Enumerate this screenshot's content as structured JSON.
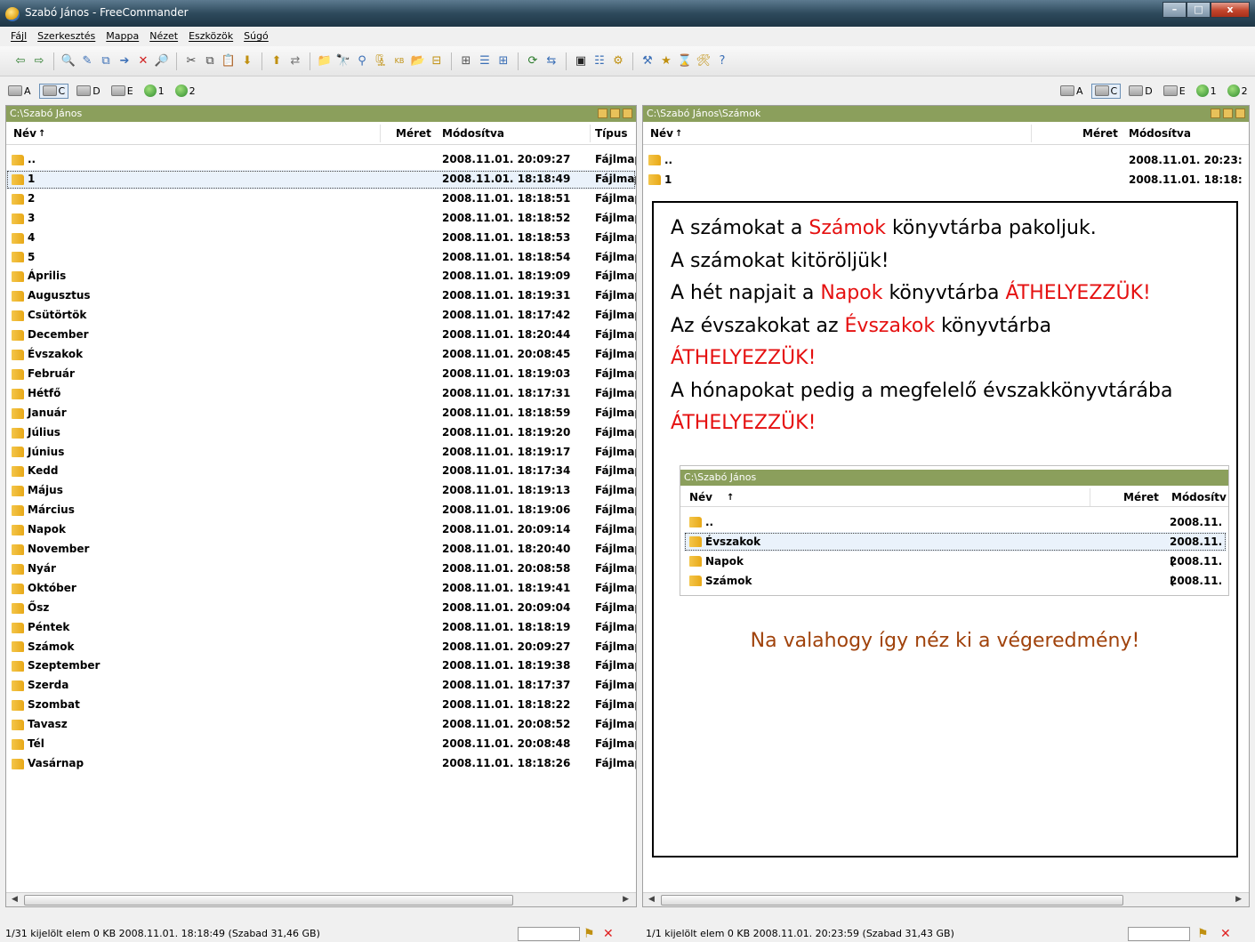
{
  "window": {
    "title": "Szabó János - FreeCommander",
    "minimize": "–",
    "maximize": "□",
    "close": "x"
  },
  "menu": [
    "Fájl",
    "Szerkesztés",
    "Mappa",
    "Nézet",
    "Eszközök",
    "Súgó"
  ],
  "toolbar_icons": [
    "back-icon",
    "forward-icon",
    "view-icon",
    "edit-icon",
    "copy-icon",
    "move-icon",
    "delete-icon",
    "search-icon",
    "cut-icon",
    "copy2-icon",
    "paste-icon",
    "pack-icon",
    "unpack-icon",
    "compare-icon",
    "newfolder-icon",
    "find-icon",
    "filter-icon",
    "archive-icon",
    "kb-icon",
    "folder-icon",
    "size-icon",
    "tree-icon",
    "details-icon",
    "thumbs-icon",
    "refresh-icon",
    "sync-icon",
    "console-icon",
    "props-icon",
    "settings-icon",
    "plugin-icon",
    "favorites-icon",
    "history-icon",
    "tools-icon",
    "help-icon"
  ],
  "drives": [
    {
      "letter": "A",
      "icon": "floppy-drive-icon"
    },
    {
      "letter": "C",
      "icon": "hard-drive-icon",
      "active": true
    },
    {
      "letter": "D",
      "icon": "cd-drive-icon"
    },
    {
      "letter": "E",
      "icon": "removable-drive-icon"
    },
    {
      "letter": "1",
      "icon": "network-drive-icon"
    },
    {
      "letter": "2",
      "icon": "ftp-icon"
    }
  ],
  "left_panel": {
    "path": "C:\\Szabó János",
    "columns": {
      "name": "Név",
      "sort": "↑",
      "size": "Méret",
      "modified": "Módosítva",
      "type": "Típus"
    },
    "rows": [
      {
        "name": "..",
        "date": "2008.11.01. 20:09:27",
        "type": "Fájlmappa"
      },
      {
        "name": "1",
        "date": "2008.11.01. 18:18:49",
        "type": "Fájlmappa",
        "selected": true
      },
      {
        "name": "2",
        "date": "2008.11.01. 18:18:51",
        "type": "Fájlmappa"
      },
      {
        "name": "3",
        "date": "2008.11.01. 18:18:52",
        "type": "Fájlmappa"
      },
      {
        "name": "4",
        "date": "2008.11.01. 18:18:53",
        "type": "Fájlmappa"
      },
      {
        "name": "5",
        "date": "2008.11.01. 18:18:54",
        "type": "Fájlmappa"
      },
      {
        "name": "Április",
        "date": "2008.11.01. 18:19:09",
        "type": "Fájlmappa"
      },
      {
        "name": "Augusztus",
        "date": "2008.11.01. 18:19:31",
        "type": "Fájlmappa"
      },
      {
        "name": "Csütörtök",
        "date": "2008.11.01. 18:17:42",
        "type": "Fájlmappa"
      },
      {
        "name": "December",
        "date": "2008.11.01. 18:20:44",
        "type": "Fájlmappa"
      },
      {
        "name": "Évszakok",
        "date": "2008.11.01. 20:08:45",
        "type": "Fájlmappa"
      },
      {
        "name": "Február",
        "date": "2008.11.01. 18:19:03",
        "type": "Fájlmappa"
      },
      {
        "name": "Hétfő",
        "date": "2008.11.01. 18:17:31",
        "type": "Fájlmappa"
      },
      {
        "name": "Január",
        "date": "2008.11.01. 18:18:59",
        "type": "Fájlmappa"
      },
      {
        "name": "Július",
        "date": "2008.11.01. 18:19:20",
        "type": "Fájlmappa"
      },
      {
        "name": "Június",
        "date": "2008.11.01. 18:19:17",
        "type": "Fájlmappa"
      },
      {
        "name": "Kedd",
        "date": "2008.11.01. 18:17:34",
        "type": "Fájlmappa"
      },
      {
        "name": "Május",
        "date": "2008.11.01. 18:19:13",
        "type": "Fájlmappa"
      },
      {
        "name": "Március",
        "date": "2008.11.01. 18:19:06",
        "type": "Fájlmappa"
      },
      {
        "name": "Napok",
        "date": "2008.11.01. 20:09:14",
        "type": "Fájlmappa"
      },
      {
        "name": "November",
        "date": "2008.11.01. 18:20:40",
        "type": "Fájlmappa"
      },
      {
        "name": "Nyár",
        "date": "2008.11.01. 20:08:58",
        "type": "Fájlmappa"
      },
      {
        "name": "Október",
        "date": "2008.11.01. 18:19:41",
        "type": "Fájlmappa"
      },
      {
        "name": "Ősz",
        "date": "2008.11.01. 20:09:04",
        "type": "Fájlmappa"
      },
      {
        "name": "Péntek",
        "date": "2008.11.01. 18:18:19",
        "type": "Fájlmappa"
      },
      {
        "name": "Számok",
        "date": "2008.11.01. 20:09:27",
        "type": "Fájlmappa"
      },
      {
        "name": "Szeptember",
        "date": "2008.11.01. 18:19:38",
        "type": "Fájlmappa"
      },
      {
        "name": "Szerda",
        "date": "2008.11.01. 18:17:37",
        "type": "Fájlmappa"
      },
      {
        "name": "Szombat",
        "date": "2008.11.01. 18:18:22",
        "type": "Fájlmappa"
      },
      {
        "name": "Tavasz",
        "date": "2008.11.01. 20:08:52",
        "type": "Fájlmappa"
      },
      {
        "name": "Tél",
        "date": "2008.11.01. 20:08:48",
        "type": "Fájlmappa"
      },
      {
        "name": "Vasárnap",
        "date": "2008.11.01. 18:18:26",
        "type": "Fájlmappa"
      }
    ],
    "status": "1/31 kijelölt elem   0 KB  2008.11.01. 18:18:49     (Szabad 31,46 GB)"
  },
  "right_panel": {
    "path": "C:\\Szabó János\\Számok",
    "columns": {
      "name": "Név",
      "sort": "↑",
      "size": "Méret",
      "modified": "Módosítva"
    },
    "rows": [
      {
        "name": "..",
        "date": "2008.11.01. 20:23:"
      },
      {
        "name": "1",
        "date": "2008.11.01. 18:18:"
      }
    ],
    "status": "1/1 kijelölt elem   0 KB  2008.11.01. 20:23:59     (Szabad 31,43 GB)"
  },
  "note": {
    "lines": [
      {
        "parts": [
          {
            "t": "A számokat a ",
            "red": false
          },
          {
            "t": "Számok",
            "red": true
          },
          {
            "t": " könyvtárba pakoljuk.",
            "red": false
          }
        ]
      },
      {
        "parts": [
          {
            "t": "A számokat kitöröljük!",
            "red": false
          }
        ]
      },
      {
        "parts": [
          {
            "t": "A hét napjait a ",
            "red": false
          },
          {
            "t": "Napok",
            "red": true
          },
          {
            "t": " könyvtárba ",
            "red": false
          },
          {
            "t": "ÁTHELYEZZÜK!",
            "red": true
          }
        ]
      },
      {
        "parts": [
          {
            "t": "Az évszakokat az ",
            "red": false
          },
          {
            "t": "Évszakok",
            "red": true
          },
          {
            "t": " könyvtárba",
            "red": false
          }
        ]
      },
      {
        "parts": [
          {
            "t": "ÁTHELYEZZÜK!",
            "red": true
          }
        ]
      },
      {
        "parts": [
          {
            "t": "A hónapokat pedig a megfelelő évszakkönyvtárába",
            "red": false
          }
        ]
      },
      {
        "parts": [
          {
            "t": "ÁTHELYEZZÜK!",
            "red": true
          }
        ]
      }
    ],
    "final": "Na valahogy így néz ki a végeredmény!"
  },
  "inset": {
    "path": "C:\\Szabó János",
    "columns": {
      "name": "Név",
      "sort": "↑",
      "size": "Méret",
      "modified": "Módosítv"
    },
    "rows": [
      {
        "name": "..",
        "date": "2008.11.("
      },
      {
        "name": "Évszakok",
        "date": "2008.11.(",
        "selected": true
      },
      {
        "name": "Napok",
        "date": "2008.11.("
      },
      {
        "name": "Számok",
        "date": "2008.11.("
      }
    ]
  },
  "colors": {
    "titlebar": "#2e4a5c",
    "pathbar": "#8b9f5c",
    "accent_red": "#e51010",
    "final_text": "#a0420b",
    "folder": "#e8a817"
  }
}
